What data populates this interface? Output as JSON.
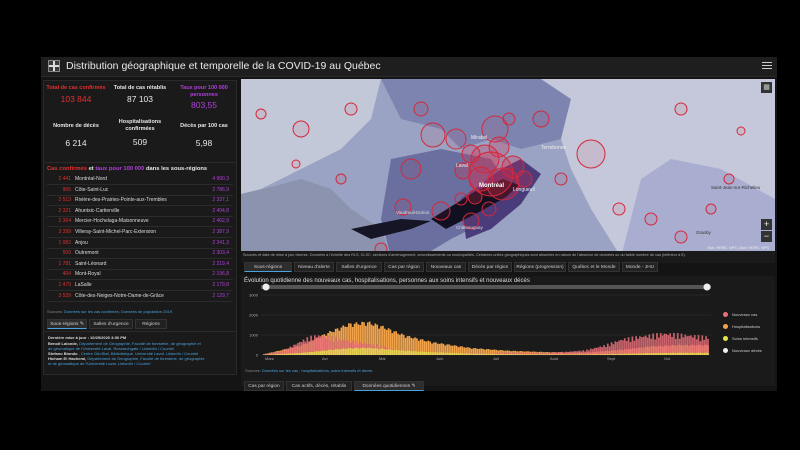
{
  "header": {
    "title": "Distribution géographique et temporelle de la COVID-19 au Québec"
  },
  "stats": [
    {
      "label": "Total de cas confirmés",
      "value": "103 844",
      "color": "red"
    },
    {
      "label": "Total de cas rétablis",
      "value": "87 103",
      "color": "white"
    },
    {
      "label": "Taux pour 100 000 personnes",
      "value": "803,55",
      "color": "purple"
    },
    {
      "label": "Nombre de décès",
      "value": "6 214",
      "color": "white"
    },
    {
      "label": "Hospitalisations confirmées",
      "value": "509",
      "color": "white"
    },
    {
      "label": "Décès par 100 cas",
      "value": "5,98",
      "color": "white"
    }
  ],
  "regions": {
    "title_parts": [
      "Cas confirmés",
      " et ",
      "taux pour 100 000",
      " dans les sous-régions"
    ],
    "rows": [
      {
        "cases": "2 441",
        "name": "Montréal-Nord",
        "rate": "4 990,3"
      },
      {
        "cases": "965",
        "name": "Côte-Saint-Luc",
        "rate": "2 786,9"
      },
      {
        "cases": "2 513",
        "name": "Rivière-des-Prairies-Pointe-aux-Trembles",
        "rate": "2 337,1"
      },
      {
        "cases": "2 321",
        "name": "Ahuntsic-Cartierville",
        "rate": "2 404,8"
      },
      {
        "cases": "2 364",
        "name": "Mercier-Hochelaga-Maisonneuve",
        "rate": "2 462,9"
      },
      {
        "cases": "3 399",
        "name": "Villeray-Saint-Michel-Parc-Extension",
        "rate": "2 387,9"
      },
      {
        "cases": "1 082",
        "name": "Anjou",
        "rate": "2 341,3"
      },
      {
        "cases": "509",
        "name": "Outremont",
        "rate": "2 303,4"
      },
      {
        "cases": "1 781",
        "name": "Saint-Léonard",
        "rate": "2 219,4"
      },
      {
        "cases": "404",
        "name": "Mont-Royal",
        "rate": "2 196,8"
      },
      {
        "cases": "1 479",
        "name": "LaSalle",
        "rate": "2 179,8"
      },
      {
        "cases": "3 539",
        "name": "Côte-des-Neiges-Notre-Dame-de-Grâce",
        "rate": "2 129,7"
      }
    ],
    "source_label": "Sources:",
    "source_link": "Données sur les cas confirmés; Données de population 2019",
    "tabs": [
      "Sous-régions",
      "Salles d'urgence",
      "Régions"
    ]
  },
  "info": {
    "updated": "Dernière mise à jour : 10/29/2020 3:00 PM",
    "lines": [
      {
        "name": "Benoît Lalonde,",
        "text": " Département de Géographie, Faculté de foresterie, de géographie et"
      },
      {
        "name": "",
        "text": "de géomatique de l'Université Laval. Researchgate / LinkedIn / Courriel"
      },
      {
        "name": "Stefano Biondo",
        "text": " , Centre GéoStat, Bibliothèque, Université Laval. LinkedIn / Courriel"
      },
      {
        "name": "Hicham El Hachemi,",
        "text": " Département de Géographie, Faculté de foresterie, de géographie"
      },
      {
        "name": "",
        "text": "et de géomatique de l'Université Laval. LinkedIn / Courriel"
      }
    ]
  },
  "map": {
    "labels": [
      "Mirabel",
      "Terrebonne",
      "Montréal",
      "Laval",
      "Longueuil",
      "Saint-Jean-sur-Richelieu",
      "Granby",
      "Vaudreuil-Dorion",
      "Châteauguay"
    ],
    "source": "Sources et date de mise à jour diverse. Données à l'échelle des RLS, CLSC, secteurs d'aménagement, arrondissements ou municipalités. Certaines unités géographiques sont absentes en raison de l'absence de données ou du faible nombre de cas (inférieur à 5).",
    "attribution": "Esri, HERE, NPS | Esri, HERE, NPS",
    "tabs": [
      "Sous-régions",
      "Niveau d'alerte",
      "Salles d'urgence",
      "Cas par région",
      "Nouveaux cas",
      "Décès par région",
      "Régions (progression)",
      "Québec et le Monde",
      "Monde - JHU"
    ]
  },
  "chart": {
    "title": "Évolution quotidienne des nouveaux cas, hospitalisations, personnes aux soins intensifs et nouveaux décès",
    "source_label": "Sources:",
    "source_link": "Données sur les cas ; hospitalisations, soins intensifs et décès",
    "tabs": [
      "Cas par région",
      "Cas actifs, décès, rétablis",
      "Données quotidiennes"
    ]
  },
  "chart_data": {
    "type": "bar",
    "x": [
      "Mars",
      "Avr",
      "Mai",
      "Juin",
      "Juil",
      "Août",
      "Sept",
      "Oct"
    ],
    "ylim": [
      0,
      3000
    ],
    "yticks": [
      0,
      1000,
      2000,
      3000
    ],
    "series": [
      {
        "name": "Nouveaux cas",
        "color": "#e8707a"
      },
      {
        "name": "Hospitalisations",
        "color": "#f2a34a"
      },
      {
        "name": "Soins intensifs",
        "color": "#e3e64a"
      },
      {
        "name": "Nouveaux décès",
        "color": "#eeeeee"
      }
    ],
    "new_cases_profile": [
      [
        0,
        50
      ],
      [
        10,
        200
      ],
      [
        18,
        650
      ],
      [
        24,
        950
      ],
      [
        30,
        1050
      ],
      [
        38,
        900
      ],
      [
        46,
        750
      ],
      [
        54,
        640
      ],
      [
        62,
        500
      ],
      [
        70,
        250
      ],
      [
        80,
        120
      ],
      [
        90,
        80
      ],
      [
        100,
        100
      ],
      [
        110,
        120
      ],
      [
        118,
        90
      ],
      [
        130,
        150
      ],
      [
        140,
        120
      ],
      [
        150,
        120
      ],
      [
        160,
        170
      ],
      [
        170,
        250
      ],
      [
        180,
        500
      ],
      [
        190,
        850
      ],
      [
        200,
        1000
      ],
      [
        212,
        1150
      ],
      [
        225,
        1050
      ],
      [
        235,
        950
      ]
    ],
    "hospital_profile": [
      [
        0,
        40
      ],
      [
        20,
        500
      ],
      [
        35,
        1200
      ],
      [
        45,
        1600
      ],
      [
        55,
        1700
      ],
      [
        62,
        1500
      ],
      [
        75,
        1000
      ],
      [
        90,
        650
      ],
      [
        110,
        360
      ],
      [
        130,
        220
      ],
      [
        150,
        150
      ],
      [
        170,
        130
      ],
      [
        190,
        280
      ],
      [
        205,
        450
      ],
      [
        220,
        520
      ],
      [
        235,
        520
      ]
    ]
  }
}
